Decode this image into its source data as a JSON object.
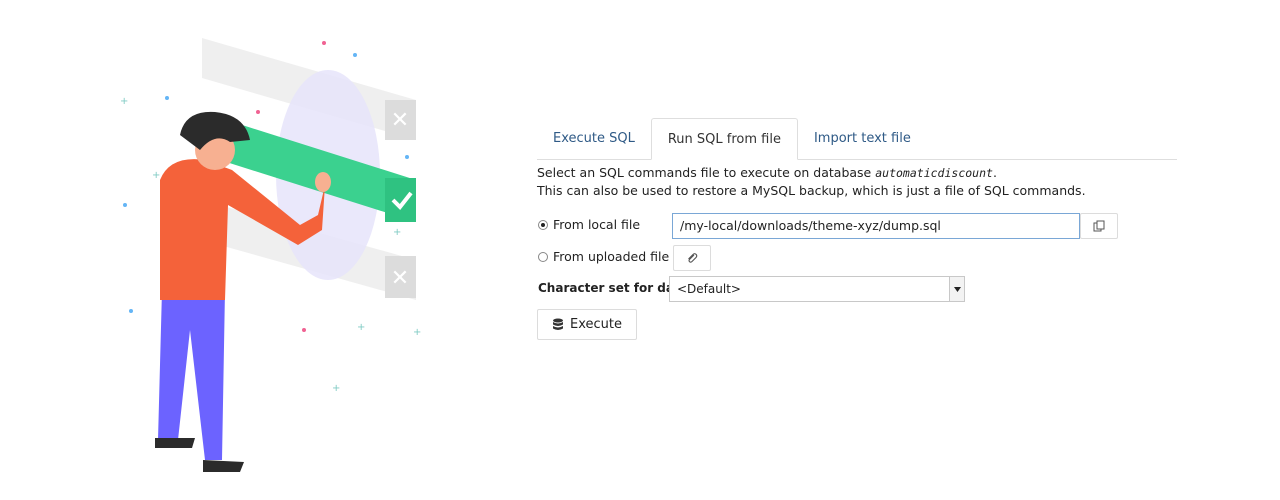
{
  "tabs": [
    {
      "label": "Execute SQL",
      "active": false
    },
    {
      "label": "Run SQL from file",
      "active": true
    },
    {
      "label": "Import text file",
      "active": false
    }
  ],
  "description": {
    "line1_prefix": "Select an SQL commands file to execute on database",
    "database": "automaticdiscount",
    "line1_suffix": ".",
    "line2": "This can also be used to restore a MySQL backup, which is just a file of SQL commands."
  },
  "source": {
    "local_label": "From local file",
    "local_value": "/my-local/downloads/theme-xyz/dump.sql",
    "local_selected": true,
    "uploaded_label": "From uploaded file",
    "uploaded_selected": false
  },
  "charset": {
    "label": "Character set for data",
    "value": "<Default>"
  },
  "execute_label": "Execute",
  "icons": {
    "browse": "copy-icon",
    "attach": "paperclip-icon",
    "execute": "database-icon"
  },
  "colors": {
    "link": "#2f5a86",
    "accent_green": "#3bd18f",
    "shirt": "#f4623a",
    "pants": "#6c63ff"
  }
}
